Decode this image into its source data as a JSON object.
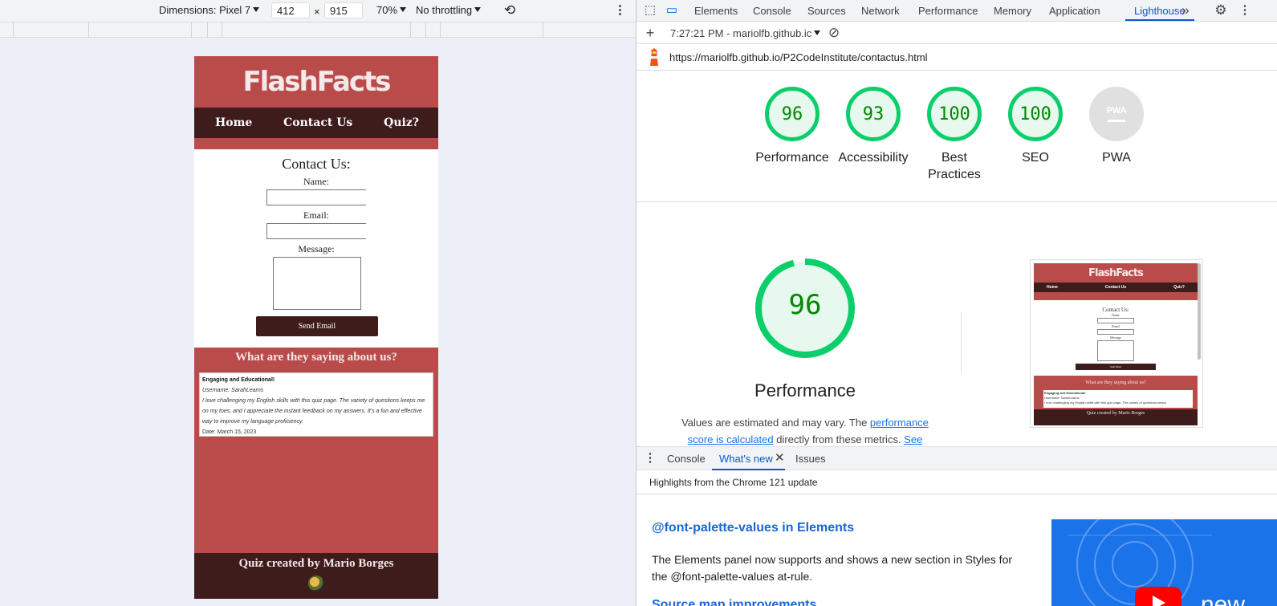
{
  "device_toolbar": {
    "dimensions_label": "Dimensions: Pixel 7",
    "width_value": "412",
    "times": "×",
    "height_value": "915",
    "zoom": "70%",
    "throttling": "No throttling"
  },
  "site": {
    "title": "FlashFacts",
    "nav": [
      "Home",
      "Contact Us",
      "Quiz?"
    ],
    "contact_title": "Contact Us:",
    "name_label": "Name:",
    "email_label": "Email:",
    "message_label": "Message:",
    "send_button": "Send Email",
    "testimonials_title": "What are they saying about us?",
    "testimonial": {
      "heading": "Engaging and Educational!",
      "username": "Username: SarahLearns",
      "body": "I love challenging my English skills with this quiz page. The variety of questions keeps me on my toes, and I appreciate the instant feedback on my answers. It's a fun and effective way to improve my language proficiency.",
      "date": "Date: March 15, 2023"
    },
    "footer": "Quiz created by Mario Borges"
  },
  "devtools": {
    "tabs": [
      "Elements",
      "Console",
      "Sources",
      "Network",
      "Performance",
      "Memory",
      "Application",
      "Lighthouse"
    ],
    "active_tab": "Lighthouse",
    "report_selector": "7:27:21 PM - mariolfb.github.ic",
    "url": "https://mariolfb.github.io/P2CodeInstitute/contactus.html",
    "scores": [
      {
        "label": "Performance",
        "value": "96"
      },
      {
        "label": "Accessibility",
        "value": "93"
      },
      {
        "label": "Best Practices",
        "value": "100"
      },
      {
        "label": "SEO",
        "value": "100"
      },
      {
        "label": "PWA",
        "value": "PWA"
      }
    ],
    "performance": {
      "score": "96",
      "score_fraction": 0.96,
      "title": "Performance",
      "note_prefix": "Values are estimated and may vary. The ",
      "note_link1": "performance score is calculated",
      "note_mid": " directly from these metrics. ",
      "note_link2": "See calculator."
    },
    "thumbnail": {
      "title": "FlashFacts",
      "nav": [
        "Home",
        "Contact Us",
        "Quiz?"
      ],
      "contact_title": "Contact Us:",
      "name_label": "Name",
      "email_label": "Email",
      "message_label": "Message",
      "send_button": "Send Email",
      "saying": "What are they saying about us?",
      "card_heading": "Engaging and Educational!",
      "card_user": "Username: SarahLearns",
      "card_body": "I love challenging my English skills with this quiz page. The variety of questions keeps",
      "footer": "Quiz created by Mario Borges"
    },
    "drawer_tabs": [
      "Console",
      "What's new",
      "Issues"
    ],
    "active_drawer_tab": "What's new",
    "whats_new_header": "Highlights from the Chrome 121 update",
    "feature1_title": "@font-palette-values in Elements",
    "feature1_desc": "The Elements panel now supports and shows a new section in Styles for the @font-palette-values at-rule.",
    "feature2_title": "Source map improvements",
    "video_text": "new"
  },
  "colors": {
    "site_red": "#b94c4b",
    "site_dark": "#3e1c1c",
    "score_green": "#0cce6b",
    "devtools_blue": "#0b57d0"
  }
}
